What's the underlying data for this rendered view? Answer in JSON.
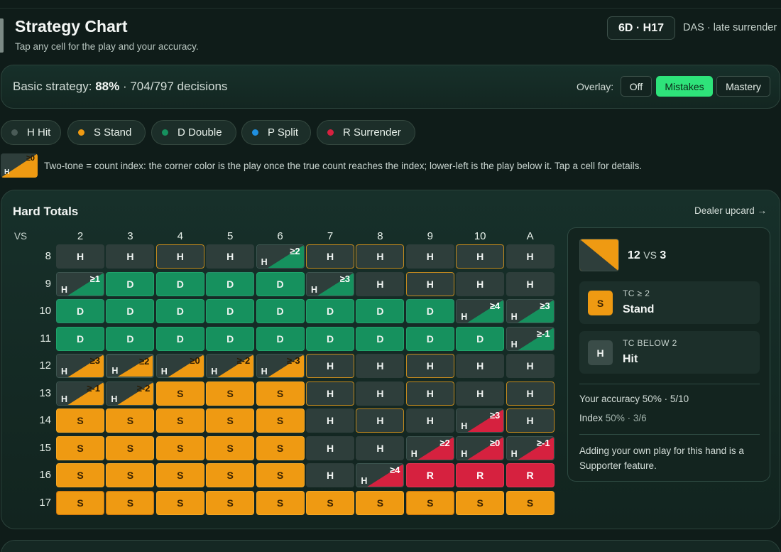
{
  "header": {
    "title": "Strategy Chart",
    "subtitle": "Tap any cell for the play and your accuracy.",
    "rules_badge": "6D · H17",
    "rules_text": "DAS · late surrender"
  },
  "summary": {
    "prefix": "Basic strategy: ",
    "accuracy": "88%",
    "decisions": " · 704/797 decisions",
    "overlay_label": "Overlay:",
    "overlay_options": [
      "Off",
      "Mistakes",
      "Mastery"
    ],
    "overlay_selected": "Mistakes"
  },
  "legend": [
    {
      "label": "H Hit",
      "color": "#4a5b57"
    },
    {
      "label": "S Stand",
      "color": "#ef9a12"
    },
    {
      "label": "D Double",
      "color": "#16915e"
    },
    {
      "label": "P Split",
      "color": "#1f8fe0"
    },
    {
      "label": "R Surrender",
      "color": "#d6213f"
    }
  ],
  "index_note": {
    "swatch_index": "≥0",
    "swatch_base": "H",
    "text": "Two-tone = count index: the corner color is the play once the true count reaches the index; lower-left is the play below it. Tap a cell for details."
  },
  "colors": {
    "H": "#2e3e3b",
    "S": "#ef9a12",
    "D": "#16915e",
    "R": "#d6213f",
    "accent": "#2ee37a"
  },
  "hard_totals": {
    "title": "Hard Totals",
    "dealer_label": "Dealer upcard →",
    "vs_label": "VS",
    "dealer_cards": [
      "2",
      "3",
      "4",
      "5",
      "6",
      "7",
      "8",
      "9",
      "10",
      "A"
    ],
    "rows": [
      {
        "total": "8",
        "cells": [
          {
            "play": "H"
          },
          {
            "play": "H"
          },
          {
            "play": "H",
            "mistake": true
          },
          {
            "play": "H"
          },
          {
            "play": "D",
            "base": "H",
            "index": "≥2"
          },
          {
            "play": "H",
            "mistake": true
          },
          {
            "play": "H",
            "mistake": true
          },
          {
            "play": "H"
          },
          {
            "play": "H",
            "mistake": true
          },
          {
            "play": "H"
          }
        ]
      },
      {
        "total": "9",
        "cells": [
          {
            "play": "D",
            "base": "H",
            "index": "≥1"
          },
          {
            "play": "D"
          },
          {
            "play": "D"
          },
          {
            "play": "D",
            "mistake": true
          },
          {
            "play": "D"
          },
          {
            "play": "D",
            "base": "H",
            "index": "≥3"
          },
          {
            "play": "H"
          },
          {
            "play": "H",
            "mistake": true
          },
          {
            "play": "H"
          },
          {
            "play": "H"
          }
        ]
      },
      {
        "total": "10",
        "cells": [
          {
            "play": "D",
            "mistake": true
          },
          {
            "play": "D"
          },
          {
            "play": "D"
          },
          {
            "play": "D"
          },
          {
            "play": "D"
          },
          {
            "play": "D"
          },
          {
            "play": "D"
          },
          {
            "play": "D",
            "mistake": true
          },
          {
            "play": "D",
            "base": "H",
            "index": "≥4"
          },
          {
            "play": "D",
            "base": "H",
            "index": "≥3"
          }
        ]
      },
      {
        "total": "11",
        "cells": [
          {
            "play": "D"
          },
          {
            "play": "D"
          },
          {
            "play": "D"
          },
          {
            "play": "D"
          },
          {
            "play": "D"
          },
          {
            "play": "D"
          },
          {
            "play": "D"
          },
          {
            "play": "D"
          },
          {
            "play": "D"
          },
          {
            "play": "D",
            "base": "H",
            "index": "≥-1"
          }
        ]
      },
      {
        "total": "12",
        "cells": [
          {
            "play": "S",
            "base": "H",
            "index": "≥3"
          },
          {
            "play": "S",
            "base": "H",
            "index": "≥2",
            "selected": true
          },
          {
            "play": "S",
            "base": "H",
            "index": "≥0"
          },
          {
            "play": "S",
            "base": "H",
            "index": "≥-2"
          },
          {
            "play": "S",
            "base": "H",
            "index": "≥-3"
          },
          {
            "play": "H",
            "mistake": true
          },
          {
            "play": "H"
          },
          {
            "play": "H",
            "mistake": true
          },
          {
            "play": "H"
          },
          {
            "play": "H"
          }
        ]
      },
      {
        "total": "13",
        "cells": [
          {
            "play": "S",
            "base": "H",
            "index": "≥-1"
          },
          {
            "play": "S",
            "base": "H",
            "index": "≥-2"
          },
          {
            "play": "S"
          },
          {
            "play": "S"
          },
          {
            "play": "S"
          },
          {
            "play": "H",
            "mistake": true
          },
          {
            "play": "H"
          },
          {
            "play": "H",
            "mistake": true
          },
          {
            "play": "H"
          },
          {
            "play": "H",
            "mistake": true
          }
        ]
      },
      {
        "total": "14",
        "cells": [
          {
            "play": "S"
          },
          {
            "play": "S"
          },
          {
            "play": "S"
          },
          {
            "play": "S"
          },
          {
            "play": "S"
          },
          {
            "play": "H"
          },
          {
            "play": "H",
            "mistake": true
          },
          {
            "play": "H"
          },
          {
            "play": "R",
            "base": "H",
            "index": "≥3"
          },
          {
            "play": "H",
            "mistake": true
          }
        ]
      },
      {
        "total": "15",
        "cells": [
          {
            "play": "S"
          },
          {
            "play": "S"
          },
          {
            "play": "S"
          },
          {
            "play": "S"
          },
          {
            "play": "S"
          },
          {
            "play": "H"
          },
          {
            "play": "H"
          },
          {
            "play": "R",
            "base": "H",
            "index": "≥2"
          },
          {
            "play": "R",
            "base": "H",
            "index": "≥0"
          },
          {
            "play": "R",
            "base": "H",
            "index": "≥-1"
          }
        ]
      },
      {
        "total": "16",
        "cells": [
          {
            "play": "S"
          },
          {
            "play": "S"
          },
          {
            "play": "S"
          },
          {
            "play": "S"
          },
          {
            "play": "S"
          },
          {
            "play": "H"
          },
          {
            "play": "R",
            "base": "H",
            "index": "≥4"
          },
          {
            "play": "R"
          },
          {
            "play": "R"
          },
          {
            "play": "R"
          }
        ]
      },
      {
        "total": "17",
        "cells": [
          {
            "play": "S",
            "mistake": true
          },
          {
            "play": "S",
            "mistake": true
          },
          {
            "play": "S"
          },
          {
            "play": "S"
          },
          {
            "play": "S"
          },
          {
            "play": "S"
          },
          {
            "play": "S"
          },
          {
            "play": "S",
            "mistake": true
          },
          {
            "play": "S"
          },
          {
            "play": "S"
          }
        ]
      }
    ]
  },
  "detail": {
    "hand": "12",
    "vs_word": "VS",
    "dealer": "3",
    "above": {
      "play": "S",
      "condition": "TC ≥ 2",
      "name": "Stand"
    },
    "below": {
      "play": "H",
      "condition": "TC BELOW 2",
      "name": "Hit"
    },
    "accuracy_label": "Your accuracy 50% · 5/10",
    "index_label": "Index",
    "index_value": "50% · 3/6",
    "footnote": "Adding your own play for this hand is a Supporter feature."
  }
}
